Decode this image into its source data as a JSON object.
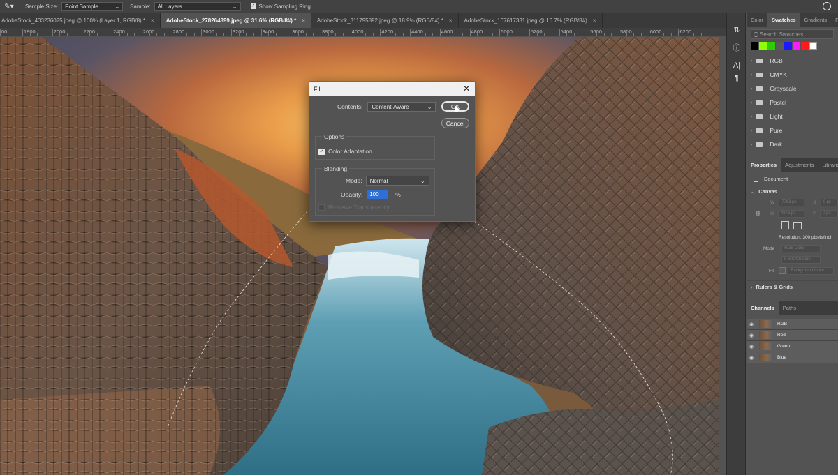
{
  "options_bar": {
    "sample_size_label": "Sample Size:",
    "sample_size_value": "Point Sample",
    "sample_label": "Sample:",
    "sample_value": "All Layers",
    "show_sampling_ring_label": "Show Sampling Ring",
    "show_sampling_ring_checked": true
  },
  "tabs": [
    {
      "label": "AdobeStock_403236025.jpeg @ 100% (Layer 1, RGB/8) *",
      "active": false
    },
    {
      "label": "AdobeStock_278264399.jpeg @ 31.6% (RGB/8#) *",
      "active": true
    },
    {
      "label": "AdobeStock_311795892.jpeg @ 18.9% (RGB/8#) *",
      "active": false
    },
    {
      "label": "AdobeStock_107617331.jpeg @ 16.7% (RGB/8#)",
      "active": false
    }
  ],
  "ruler": [
    "00",
    "1800",
    "2000",
    "2200",
    "2400",
    "2600",
    "2800",
    "3000",
    "3200",
    "3400",
    "3600",
    "3800",
    "4000",
    "4200",
    "4400",
    "4600",
    "4800",
    "5000",
    "5200",
    "5400",
    "5600",
    "5800",
    "6000",
    "6200"
  ],
  "dialog": {
    "title": "Fill",
    "contents_label": "Contents:",
    "contents_value": "Content-Aware",
    "ok_label": "OK",
    "cancel_label": "Cancel",
    "options_title": "Options",
    "color_adaptation_label": "Color Adaptation",
    "color_adaptation_checked": true,
    "blending_title": "Blending",
    "mode_label": "Mode:",
    "mode_value": "Normal",
    "opacity_label": "Opacity:",
    "opacity_value": "100",
    "opacity_unit": "%",
    "preserve_transparency_label": "Preserve Transparency",
    "preserve_transparency_checked": false
  },
  "swatches_panel": {
    "tabs": [
      "Color",
      "Swatches",
      "Gradients",
      "Patte"
    ],
    "active_tab": "Swatches",
    "search_placeholder": "Search Swatches",
    "recent_colors": [
      "#000000",
      "#8cff00",
      "#2ecc00",
      "#5a5a5a",
      "#1a1aff",
      "#ff1aff",
      "#ff1a1a",
      "#ffffff"
    ],
    "groups": [
      "RGB",
      "CMYK",
      "Grayscale",
      "Pastel",
      "Light",
      "Pure",
      "Dark"
    ]
  },
  "properties_panel": {
    "tabs": [
      "Properties",
      "Adjustments",
      "Libraries"
    ],
    "active_tab": "Properties",
    "document_label": "Document",
    "canvas_title": "Canvas",
    "w_label": "W",
    "w_value": "7763 px",
    "h_label": "H",
    "h_value": "4876 px",
    "x_label": "X",
    "x_value": "0 px",
    "y_label": "Y",
    "y_value": "0 px",
    "resolution_text": "Resolution: 300 pixels/inch",
    "mode_label": "Mode",
    "mode_value": "RGB Color",
    "bits_value": "8 Bits/Channel",
    "fill_label": "Fill",
    "fill_value": "Background Color",
    "rulers_grids_title": "Rulers & Grids"
  },
  "channels_panel": {
    "tabs": [
      "Channels",
      "Paths"
    ],
    "active_tab": "Channels",
    "channels": [
      "RGB",
      "Red",
      "Green",
      "Blue"
    ]
  }
}
